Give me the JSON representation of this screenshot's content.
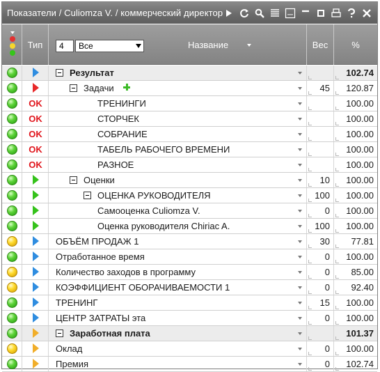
{
  "window": {
    "title": "Показатели / Culiomza V. / коммерческий директор"
  },
  "toolbar_icons": [
    "play-icon",
    "refresh-icon",
    "search-icon",
    "list-icon",
    "csv-icon",
    "minimize-icon",
    "restore-icon",
    "print-icon",
    "help-icon",
    "close-icon"
  ],
  "header": {
    "type_label": "Тип",
    "level_value": "4",
    "filter_value": "Все",
    "name_label": "Название",
    "weight_label": "Вес",
    "percent_label": "%"
  },
  "rows": [
    {
      "light": "green",
      "type": "blue",
      "indent": 0,
      "expander": true,
      "label": "Результат",
      "weight": "",
      "percent": "102.74",
      "bold": true
    },
    {
      "light": "green",
      "type": "red",
      "indent": 1,
      "expander": true,
      "label": "Задачи",
      "plus": true,
      "weight": "45",
      "percent": "120.87"
    },
    {
      "light": "green",
      "type": "ok",
      "ok_text": "OK",
      "indent": 2,
      "label": "ТРЕНИНГИ",
      "weight": "",
      "percent": "100.00"
    },
    {
      "light": "green",
      "type": "ok",
      "ok_text": "OK",
      "indent": 2,
      "label": "СТОРЧЕК",
      "weight": "",
      "percent": "100.00"
    },
    {
      "light": "green",
      "type": "ok",
      "ok_text": "OK",
      "indent": 2,
      "label": "СОБРАНИЕ",
      "weight": "",
      "percent": "100.00"
    },
    {
      "light": "green",
      "type": "ok",
      "ok_text": "OK",
      "indent": 2,
      "label": "ТАБЕЛЬ РАБОЧЕГО ВРЕМЕНИ",
      "weight": "",
      "percent": "100.00"
    },
    {
      "light": "green",
      "type": "ok",
      "ok_text": "OK",
      "indent": 2,
      "label": "РАЗНОЕ",
      "weight": "",
      "percent": "100.00"
    },
    {
      "light": "green",
      "type": "green",
      "indent": 1,
      "expander": true,
      "label": "Оценки",
      "weight": "10",
      "percent": "100.00"
    },
    {
      "light": "green",
      "type": "green",
      "indent": 2,
      "expander": true,
      "label": "ОЦЕНКА РУКОВОДИТЕЛЯ",
      "weight": "100",
      "percent": "100.00"
    },
    {
      "light": "green",
      "type": "green",
      "indent": 3,
      "label": "Самооценка Culiomza V.",
      "weight": "0",
      "percent": "100.00"
    },
    {
      "light": "green",
      "type": "green",
      "indent": 3,
      "label": "Оценка руководителя Chiriac A.",
      "weight": "100",
      "percent": "100.00"
    },
    {
      "light": "yellow",
      "type": "blue",
      "indent": 0,
      "label": "ОБЪЁМ ПРОДАЖ 1",
      "weight": "30",
      "percent": "77.81"
    },
    {
      "light": "green",
      "type": "blue",
      "indent": 0,
      "label": "Отработанное время",
      "weight": "0",
      "percent": "100.00"
    },
    {
      "light": "yellow",
      "type": "blue",
      "indent": 0,
      "label": "Количество заходов в программу",
      "weight": "0",
      "percent": "85.00"
    },
    {
      "light": "yellow",
      "type": "blue",
      "indent": 0,
      "label": "КОЭФФИЦИЕНТ ОБОРАЧИВАЕМОСТИ 1",
      "weight": "0",
      "percent": "92.40"
    },
    {
      "light": "green",
      "type": "blue",
      "indent": 0,
      "label": "ТРЕНИНГ",
      "weight": "15",
      "percent": "100.00"
    },
    {
      "light": "green",
      "type": "blue",
      "indent": 0,
      "label": "ЦЕНТР ЗАТРАТЫ эта",
      "weight": "0",
      "percent": "100.00"
    },
    {
      "light": "green",
      "type": "orange",
      "indent": 0,
      "expander": true,
      "label": "Заработная плата",
      "weight": "",
      "percent": "101.37",
      "bold": true
    },
    {
      "light": "yellow",
      "type": "orange",
      "indent": 0,
      "label": "Оклад",
      "weight": "0",
      "percent": "100.00"
    },
    {
      "light": "green",
      "type": "orange",
      "indent": 0,
      "label": "Премия",
      "weight": "0",
      "percent": "102.74"
    }
  ]
}
